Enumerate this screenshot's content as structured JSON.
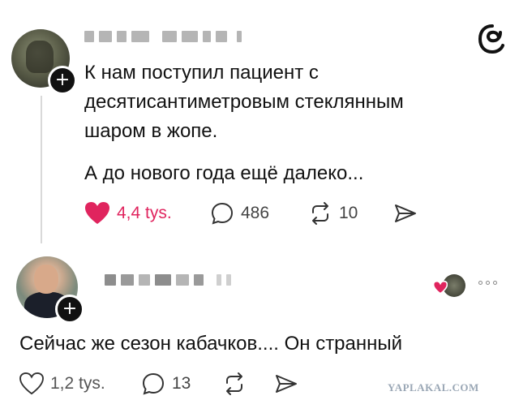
{
  "post1": {
    "text_lines": [
      "К нам поступил пациент с",
      "десятисантиметровым стеклянным",
      "шаром в жопе."
    ],
    "text_second": "А до нового года ещё далеко...",
    "likes": "4,4 tys.",
    "comments": "486",
    "reposts": "10"
  },
  "post2": {
    "text": "Сейчас же сезон кабачков.... Он странный",
    "likes": "1,2 tys.",
    "comments": "13"
  },
  "icons": {
    "logo": "threads-logo-icon",
    "follow": "plus-icon",
    "like_filled": "heart-filled-icon",
    "like": "heart-outline-icon",
    "comment": "speech-bubble-icon",
    "repost": "repost-icon",
    "share": "send-icon",
    "more": "more-dots-icon"
  },
  "colors": {
    "like_active": "#e0245e",
    "text": "#111111",
    "secondary": "#444444"
  },
  "watermark": "YAPLAKAL.COM"
}
